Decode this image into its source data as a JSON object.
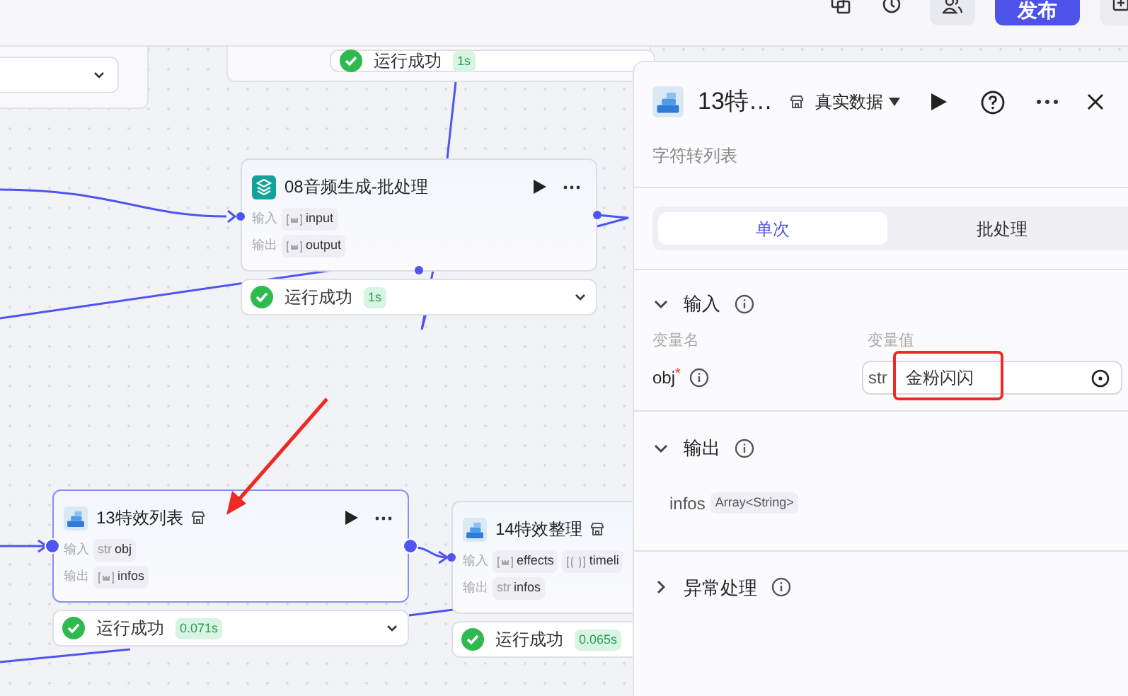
{
  "toolbar": {
    "publish_button": "发布"
  },
  "canvas": {
    "top_node_status": {
      "text": "运行成功",
      "time": "1s"
    },
    "nodes": [
      {
        "kind": "batch",
        "title": "08音频生成-批处理",
        "store_icon": false,
        "selected": false,
        "input_label": "输入",
        "inputs": [
          {
            "kind": "array",
            "name": "input"
          }
        ],
        "output_label": "输出",
        "outputs": [
          {
            "kind": "array",
            "name": "output"
          }
        ],
        "status": {
          "text": "运行成功",
          "time": "1s"
        },
        "expandable": true
      },
      {
        "kind": "plugin",
        "title": "13特效列表",
        "store_icon": true,
        "selected": true,
        "input_label": "输入",
        "inputs": [
          {
            "kind": "string",
            "type_label": "str",
            "name": "obj"
          }
        ],
        "output_label": "输出",
        "outputs": [
          {
            "kind": "array",
            "name": "infos"
          }
        ],
        "status": {
          "text": "运行成功",
          "time": "0.071s"
        },
        "expandable": true
      },
      {
        "kind": "plugin",
        "title": "14特效整理",
        "store_icon": true,
        "selected": false,
        "input_label": "输入",
        "inputs": [
          {
            "kind": "array",
            "name": "effects"
          },
          {
            "kind": "object_array",
            "name": "timeli"
          }
        ],
        "output_label": "输出",
        "outputs": [
          {
            "kind": "string",
            "type_label": "str",
            "name": "infos"
          }
        ],
        "status": {
          "text": "运行成功",
          "time": "0.065s"
        },
        "expandable": false
      }
    ]
  },
  "panel": {
    "title": "13特…",
    "data_mode": "真实数据",
    "subtitle": "字符转列表",
    "tabs": [
      {
        "label": "单次",
        "selected": true
      },
      {
        "label": "批处理",
        "selected": false
      }
    ],
    "input_section": {
      "title": "输入",
      "expanded": true,
      "name_header": "变量名",
      "value_header": "变量值",
      "params": [
        {
          "name": "obj",
          "required_mark": "*",
          "type_label": "str",
          "value": "金粉闪闪"
        }
      ]
    },
    "output_section": {
      "title": "输出",
      "expanded": true,
      "outputs": [
        {
          "name": "infos",
          "type": "Array<String>"
        }
      ]
    },
    "error_section": {
      "title": "异常处理",
      "expanded": false
    }
  }
}
